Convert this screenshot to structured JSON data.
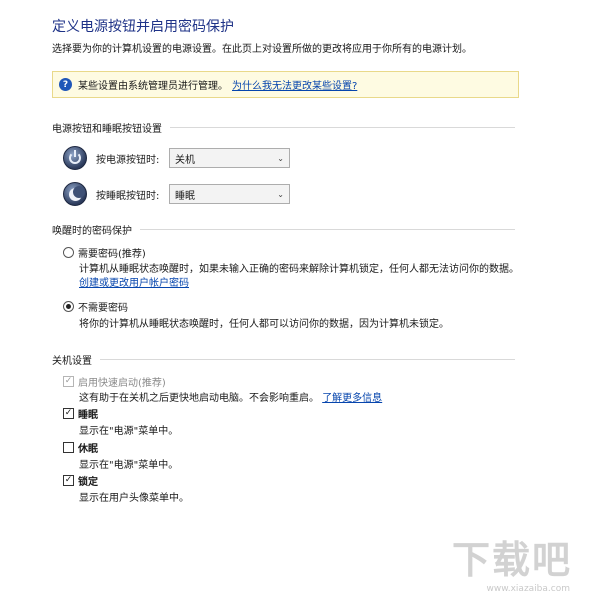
{
  "header": {
    "title": "定义电源按钮并启用密码保护",
    "subtitle": "选择要为你的计算机设置的电源设置。在此页上对设置所做的更改将应用于你所有的电源计划。"
  },
  "info_bar": {
    "icon": "question-icon",
    "text": "某些设置由系统管理员进行管理。",
    "link": "为什么我无法更改某些设置?"
  },
  "power_section": {
    "heading": "电源按钮和睡眠按钮设置",
    "rows": [
      {
        "label": "按电源按钮时:",
        "value": "关机",
        "icon": "power-icon"
      },
      {
        "label": "按睡眠按钮时:",
        "value": "睡眠",
        "icon": "sleep-icon"
      }
    ]
  },
  "password_section": {
    "heading": "唤醒时的密码保护",
    "require_label": "需要密码(推荐)",
    "require_selected": false,
    "require_desc": "计算机从睡眠状态唤醒时，如果未输入正确的密码来解除计算机锁定，任何人都无法访问你的数据。",
    "require_link": "创建或更改用户帐户密码",
    "norequire_label": "不需要密码",
    "norequire_selected": true,
    "norequire_desc": "将你的计算机从睡眠状态唤醒时，任何人都可以访问你的数据，因为计算机未锁定。"
  },
  "shutdown_section": {
    "heading": "关机设置",
    "items": [
      {
        "label": "启用快速启动(推荐)",
        "checked": true,
        "disabled": true,
        "desc": "这有助于在关机之后更快地启动电脑。不会影响重启。",
        "link": "了解更多信息"
      },
      {
        "label": "睡眠",
        "checked": true,
        "disabled": false,
        "desc": "显示在\"电源\"菜单中。"
      },
      {
        "label": "休眠",
        "checked": false,
        "disabled": false,
        "desc": "显示在\"电源\"菜单中。"
      },
      {
        "label": "锁定",
        "checked": true,
        "disabled": false,
        "desc": "显示在用户头像菜单中。"
      }
    ]
  },
  "watermark": {
    "text": "下载吧",
    "sub": "www.xiazaiba.com"
  }
}
